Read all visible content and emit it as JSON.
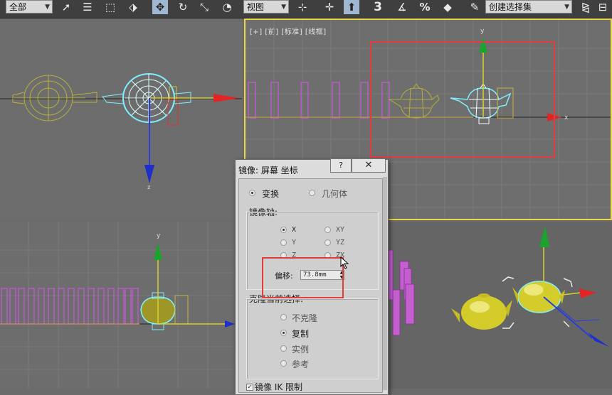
{
  "toolbar": {
    "selection_filter": "全部",
    "reference_coord": "视图",
    "named_selection": "创建选择集",
    "buttons": [
      {
        "name": "select-object-icon",
        "glyph": "➚"
      },
      {
        "name": "select-by-name-icon",
        "glyph": "☰"
      },
      {
        "name": "rect-region-icon",
        "glyph": "⬚"
      },
      {
        "name": "window-crossing-icon",
        "glyph": "⬗"
      },
      {
        "name": "move-icon",
        "glyph": "✥"
      },
      {
        "name": "rotate-icon",
        "glyph": "↻"
      },
      {
        "name": "scale-icon",
        "glyph": "⤡"
      },
      {
        "name": "place-icon",
        "glyph": "◔"
      },
      {
        "name": "pivot-icon",
        "glyph": "⊹"
      },
      {
        "name": "select-manipulate-icon",
        "glyph": "✛"
      },
      {
        "name": "keyboard-shortcut-icon",
        "glyph": "⬆"
      },
      {
        "name": "snap-3d-icon",
        "glyph": "3"
      },
      {
        "name": "angle-snap-icon",
        "glyph": "∡"
      },
      {
        "name": "percent-snap-icon",
        "glyph": "%"
      },
      {
        "name": "spinner-snap-icon",
        "glyph": "◆"
      },
      {
        "name": "edit-named-selection-icon",
        "glyph": "✎"
      },
      {
        "name": "mirror-icon",
        "glyph": "⧎"
      }
    ]
  },
  "viewports": {
    "front_label": "[+] [前] [标准] [线框]"
  },
  "dialog": {
    "title": "镜像: 屏幕 坐标",
    "help": "?",
    "close": "✕",
    "transform": "变换",
    "geometry": "几何体",
    "mirror_axis": "镜像轴:",
    "axes": [
      "X",
      "XY",
      "Y",
      "YZ",
      "Z",
      "ZX"
    ],
    "selected_axis": "X",
    "offset_label": "偏移:",
    "offset_value": "73.8mm",
    "clone_label": "克隆当前选择:",
    "clone_options": [
      "不克隆",
      "复制",
      "实例",
      "参考"
    ],
    "selected_clone": "复制",
    "ik_label": "镜像 IK 限制"
  },
  "colors": {
    "viewport_bg": "#6b6b6b",
    "highlight": "#e23c3c",
    "active_viewport_border": "#e8d84a",
    "teapot": "#c8c23a",
    "selection": "#7ff0ff"
  }
}
